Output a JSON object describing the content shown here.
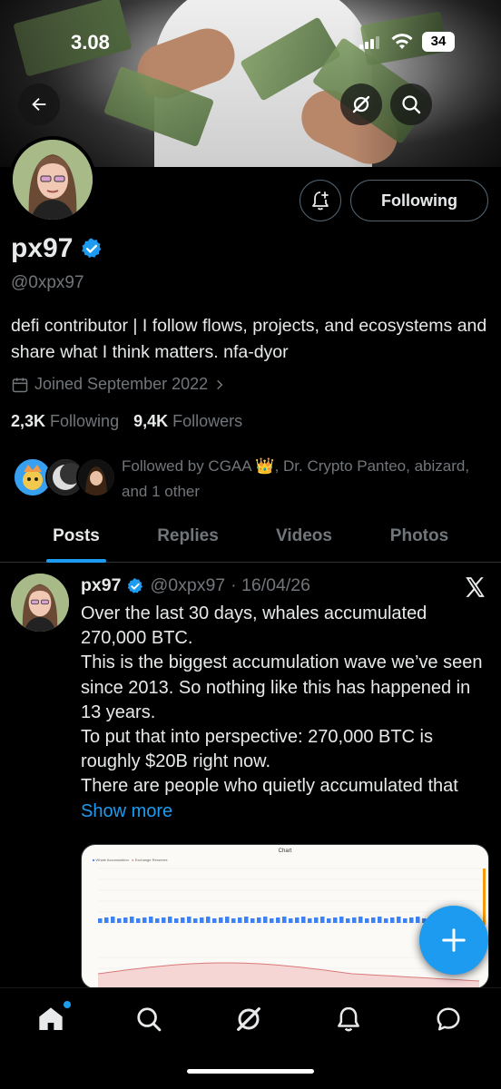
{
  "status_bar": {
    "time": "3.08",
    "battery": "34"
  },
  "profile": {
    "name": "px97",
    "handle": "@0xpx97",
    "bio": "defi contributor | I follow flows, projects, and ecosystems and share what I think matters. nfa-dyor",
    "joined": "Joined September 2022",
    "following_count": "2,3K",
    "following_label": "Following",
    "followers_count": "9,4K",
    "followers_label": "Followers",
    "follow_button": "Following",
    "followed_by": "Followed by CGAA 👑, Dr. Crypto Panteo, abizard, and 1 other"
  },
  "tabs": [
    {
      "label": "Posts"
    },
    {
      "label": "Replies"
    },
    {
      "label": "Videos"
    },
    {
      "label": "Photos"
    }
  ],
  "post": {
    "name": "px97",
    "handle": "@0xpx97",
    "date": "· 16/04/26",
    "lines": [
      "Over the last 30 days, whales accumulated 270,000 BTC.",
      "This is the biggest accumulation wave we’ve seen since 2013. So nothing like this has happened in 13 years.",
      "To put that into perspective: 270,000 BTC is roughly $20B right now.",
      "There are people who quietly accumulated that"
    ],
    "show_more": "Show more",
    "chart_title": "Chart",
    "chart_legend_1": "Whale Accumulation",
    "chart_legend_2": "Exchange Reserves"
  },
  "icons": {
    "back": "arrow-left-icon",
    "grok": "grok-icon",
    "search": "search-icon",
    "notify": "bell-plus-icon",
    "verified": "verified-badge-icon",
    "calendar": "calendar-icon",
    "x": "x-logo-icon",
    "compose": "plus-icon"
  },
  "colors": {
    "accent": "#1d9bf0",
    "muted": "#71767b",
    "background": "#000000"
  }
}
